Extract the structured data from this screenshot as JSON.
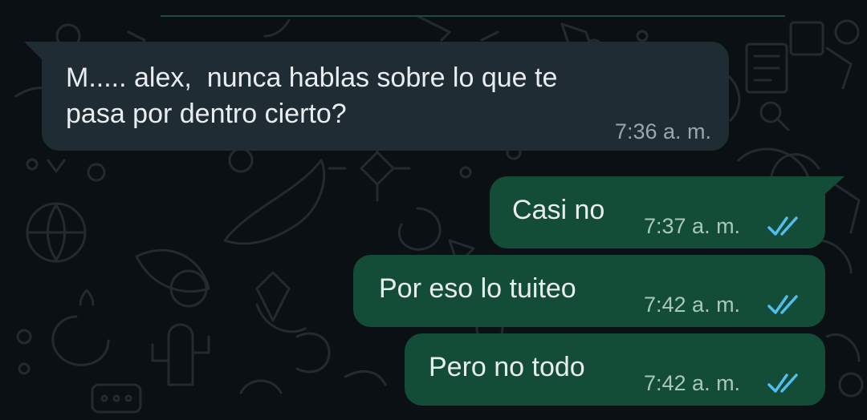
{
  "chat": {
    "messages": [
      {
        "direction": "incoming",
        "text_line1": "M..... alex,  nunca hablas sobre lo que te",
        "text_line2": "pasa por dentro cierto?",
        "time": "7:36 a. m."
      },
      {
        "direction": "outgoing",
        "text": "Casi no",
        "time": "7:37 a. m.",
        "status": "read"
      },
      {
        "direction": "outgoing",
        "text": "Por eso lo tuiteo",
        "time": "7:42 a. m.",
        "status": "read"
      },
      {
        "direction": "outgoing",
        "text": "Pero no todo",
        "time": "7:42 a. m.",
        "status": "read"
      }
    ]
  },
  "colors": {
    "wallpaper": "#0b1014",
    "incoming_bubble": "#1f2c33",
    "outgoing_bubble": "#144d37",
    "read_ticks": "#53bdeb",
    "text": "#e9edef"
  },
  "icons": {
    "read_receipt": "double-check-icon",
    "wallpaper": "doodle-pattern"
  }
}
